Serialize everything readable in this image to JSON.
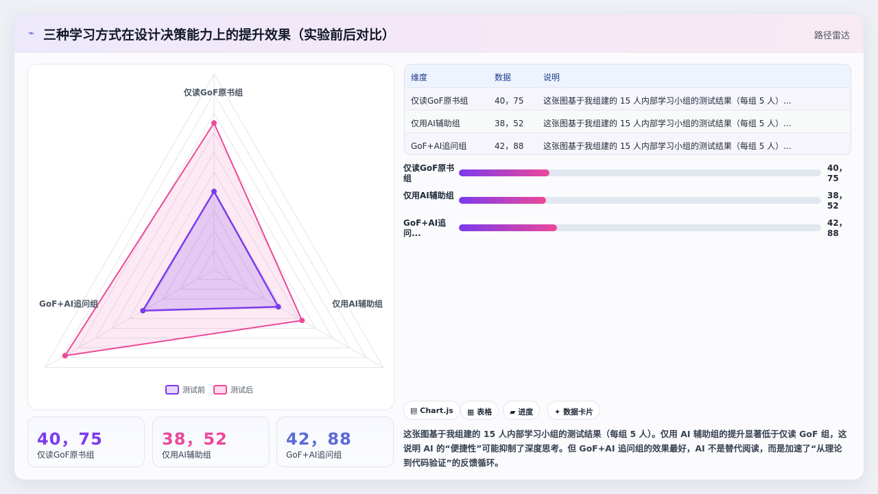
{
  "header": {
    "icon": "spark-icon",
    "title": "三种学习方式在设计决策能力上的提升效果（实验前后对比）",
    "chart_type_label": "路径雷达"
  },
  "chart_data": {
    "type": "radar",
    "title": "",
    "axes": [
      "仅读GoF原书组",
      "仅用AI辅助组",
      "GoF+AI追问组"
    ],
    "rmax": 100,
    "ring_count": 5,
    "series": [
      {
        "name": "测试前",
        "values": [
          40,
          38,
          42
        ],
        "color": "#7c3aed"
      },
      {
        "name": "测试后",
        "values": [
          75,
          52,
          88
        ],
        "color": "#ec4899"
      }
    ],
    "legend_position": "bottom"
  },
  "stats": [
    {
      "value": "40，75",
      "label": "仅读GoF原书组",
      "color": "#7c3aed"
    },
    {
      "value": "38，52",
      "label": "仅用AI辅助组",
      "color": "#ec4899"
    },
    {
      "value": "42，88",
      "label": "GoF+AI追问组",
      "color": "#5b6bd6"
    }
  ],
  "table": {
    "headers": [
      "维度",
      "数据",
      "说明"
    ],
    "rows": [
      [
        "仅读GoF原书组",
        "40，75",
        "这张图基于我组建的 15 人内部学习小组的测试结果（每组 5 人）..."
      ],
      [
        "仅用AI辅助组",
        "38，52",
        "这张图基于我组建的 15 人内部学习小组的测试结果（每组 5 人）..."
      ],
      [
        "GoF+AI追问组",
        "42，88",
        "这张图基于我组建的 15 人内部学习小组的测试结果（每组 5 人）..."
      ]
    ]
  },
  "progress": [
    {
      "label": "仅读GoF原书组",
      "value": "40，75",
      "fill": 0.25
    },
    {
      "label": "仅用AI辅助组",
      "value": "38，52",
      "fill": 0.24
    },
    {
      "label": "GoF+AI追问...",
      "value": "42，88",
      "fill": 0.27
    }
  ],
  "chips": [
    {
      "icon": "▤",
      "label": "Chart.js"
    },
    {
      "icon": "▦",
      "label": "表格"
    },
    {
      "icon": "▰",
      "label": "进度"
    },
    {
      "icon": "✦",
      "label": "数据卡片"
    }
  ],
  "description": "这张图基于我组建的 15 人内部学习小组的测试结果（每组 5 人）。仅用 AI 辅助组的提升显著低于仅读 GoF 组，这说明 AI 的“便捷性”可能抑制了深度思考。但 GoF+AI 追问组的效果最好，AI 不是替代阅读，而是加速了“从理论到代码验证”的反馈循环。"
}
